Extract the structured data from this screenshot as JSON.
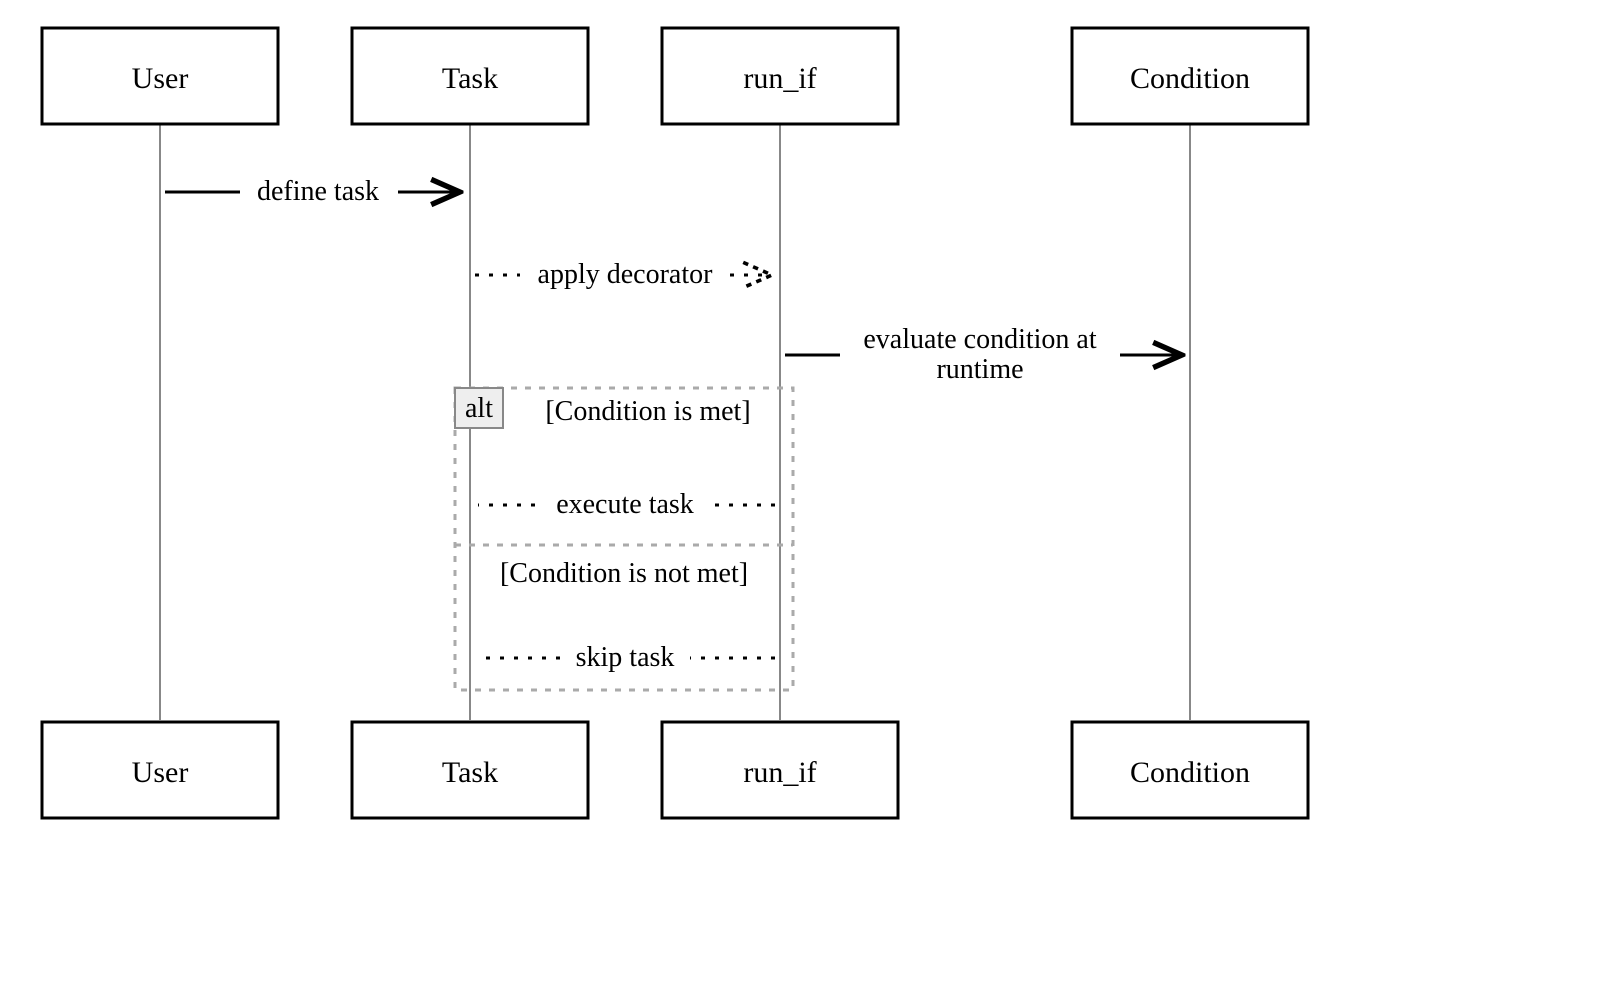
{
  "participants": {
    "user": "User",
    "task": "Task",
    "runif": "run_if",
    "condition": "Condition"
  },
  "messages": {
    "define": "define task",
    "decorator": "apply decorator",
    "evaluate1": "evaluate condition at",
    "evaluate2": "runtime",
    "exec": "execute task",
    "skip": "skip task"
  },
  "alt": {
    "label": "alt",
    "guard1": "[Condition is met]",
    "guard2": "[Condition is not met]"
  }
}
